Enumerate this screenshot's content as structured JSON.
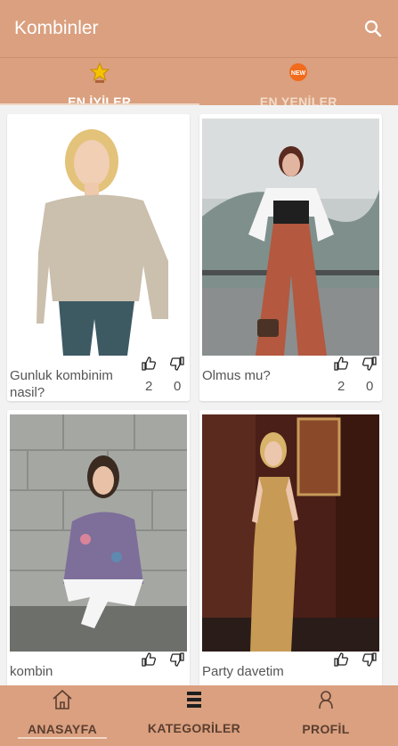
{
  "app": {
    "title": "Kombinler"
  },
  "tabs": [
    {
      "label": "EN İYİLER",
      "icon": "trophy-icon",
      "active": true
    },
    {
      "label": "EN YENİLER",
      "icon": "new-badge-icon",
      "active": false
    }
  ],
  "new_badge_text": "NEW",
  "posts": [
    {
      "caption": "Gunluk kombinim nasil?",
      "likes": "2",
      "dislikes": "0",
      "photo": "woman in beige off-shoulder sweater"
    },
    {
      "caption": "Olmus mu?",
      "likes": "2",
      "dislikes": "0",
      "photo": "woman in rust wide-leg pants"
    },
    {
      "caption": "kombin",
      "likes": "",
      "dislikes": "",
      "photo": "woman in floral off-shoulder top crouching"
    },
    {
      "caption": "Party davetim",
      "likes": "",
      "dislikes": "",
      "photo": "woman in gold sequin gown"
    }
  ],
  "bottom_nav": [
    {
      "label": "ANASAYFA",
      "icon": "home-icon",
      "active": true
    },
    {
      "label": "KATEGORİLER",
      "icon": "list-icon",
      "active": false
    },
    {
      "label": "PROFİL",
      "icon": "user-icon",
      "active": false
    }
  ],
  "colors": {
    "primary": "#daa07f",
    "nav_text": "#5b3e31",
    "background": "#f2f2f2"
  }
}
